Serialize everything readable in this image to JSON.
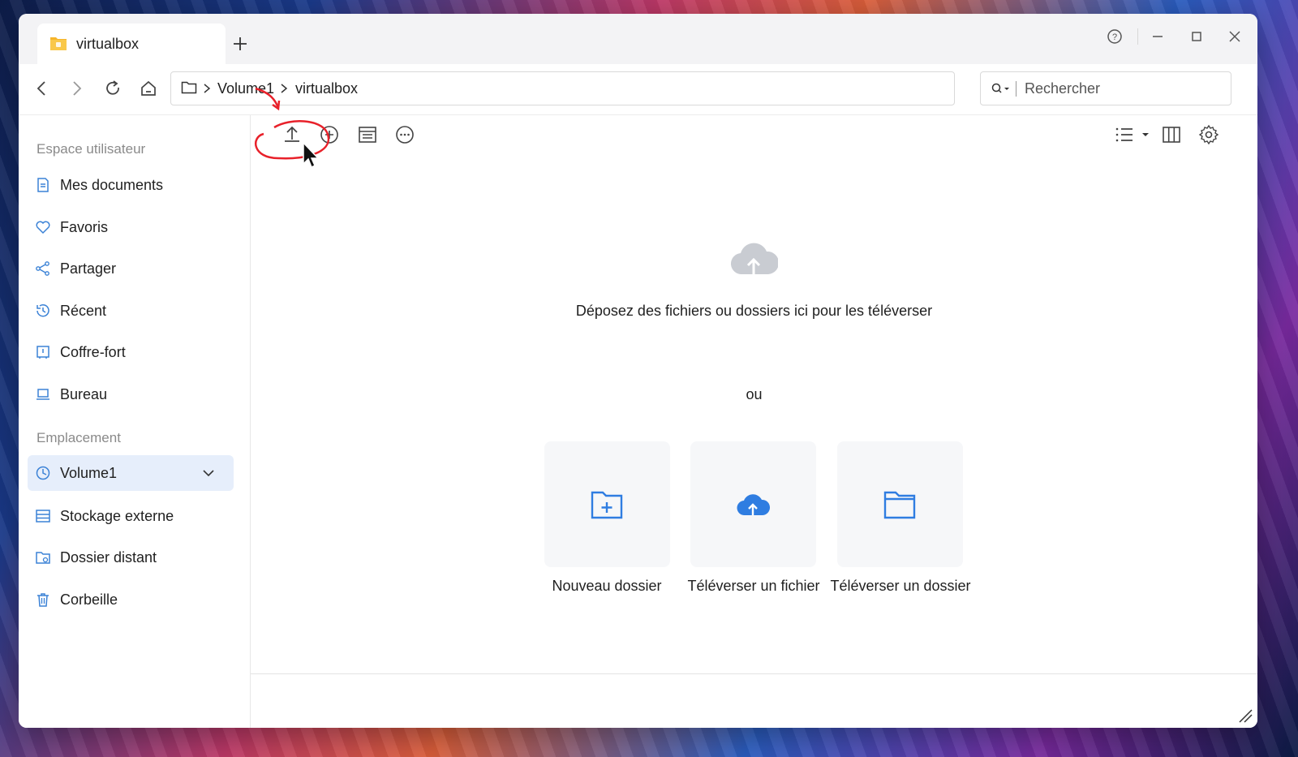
{
  "app": {
    "tab_title": "virtualbox",
    "new_tab_icon": "plus-icon"
  },
  "window_controls": {
    "help_icon": "help-icon",
    "minimize_icon": "minimize-icon",
    "maximize_icon": "maximize-icon",
    "close_icon": "close-icon"
  },
  "navigation": {
    "breadcrumb": [
      "Volume1",
      "virtualbox"
    ],
    "search_placeholder": "Rechercher"
  },
  "sidebar": {
    "section_user": "Espace utilisateur",
    "user_items": [
      {
        "label": "Mes documents",
        "icon": "document-icon"
      },
      {
        "label": "Favoris",
        "icon": "heart-icon"
      },
      {
        "label": "Partager",
        "icon": "share-icon"
      },
      {
        "label": "Récent",
        "icon": "history-icon"
      },
      {
        "label": "Coffre-fort",
        "icon": "safe-icon"
      },
      {
        "label": "Bureau",
        "icon": "laptop-icon"
      }
    ],
    "section_location": "Emplacement",
    "location_items": [
      {
        "label": "Volume1",
        "icon": "volume-icon",
        "active": true
      },
      {
        "label": "Stockage externe",
        "icon": "external-storage-icon"
      },
      {
        "label": "Dossier distant",
        "icon": "remote-folder-icon"
      },
      {
        "label": "Corbeille",
        "icon": "trash-icon"
      }
    ]
  },
  "toolbar": {
    "left": [
      "upload-icon",
      "add-circle-icon",
      "properties-icon",
      "more-icon"
    ],
    "right": [
      "list-view-icon",
      "columns-view-icon",
      "settings-icon"
    ]
  },
  "main": {
    "drop_text": "Déposez des fichiers ou dossiers ici pour les téléverser",
    "or_text": "ou",
    "cards": [
      {
        "label": "Nouveau dossier",
        "icon": "new-folder-icon"
      },
      {
        "label": "Téléverser un fichier",
        "icon": "cloud-upload-icon"
      },
      {
        "label": "Téléverser un dossier",
        "icon": "folder-icon"
      }
    ]
  },
  "colors": {
    "accent": "#2f7de1",
    "icon_blue": "#3b82d6",
    "active_bg": "#e6eefb",
    "tab_folder": "#f6b52a",
    "annotation_red": "#e8212a"
  }
}
